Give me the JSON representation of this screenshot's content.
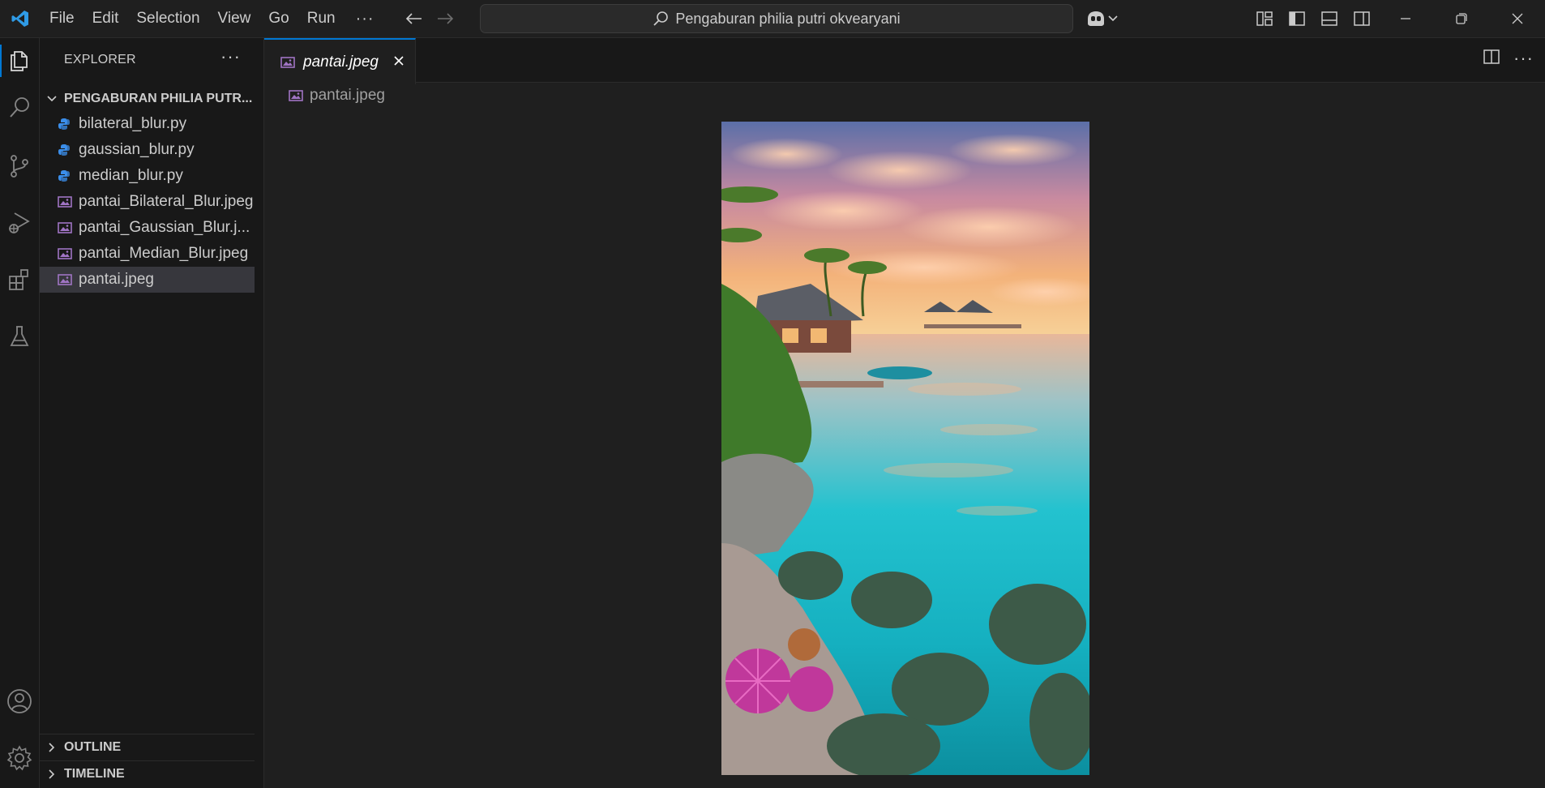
{
  "menu": [
    "File",
    "Edit",
    "Selection",
    "View",
    "Go",
    "Run"
  ],
  "menu_more": "···",
  "search_text": "Pengaburan philia putri okvearyani",
  "activity_icons": [
    "explorer-icon",
    "search-icon",
    "source-control-icon",
    "run-debug-icon",
    "extensions-icon",
    "testing-icon",
    "account-icon",
    "settings-gear-icon"
  ],
  "sidebar": {
    "title": "EXPLORER",
    "more": "···",
    "folder": "PENGABURAN PHILIA PUTR...",
    "files": [
      {
        "name": "bilateral_blur.py",
        "type": "python"
      },
      {
        "name": "gaussian_blur.py",
        "type": "python"
      },
      {
        "name": "median_blur.py",
        "type": "python"
      },
      {
        "name": "pantai_Bilateral_Blur.jpeg",
        "type": "image"
      },
      {
        "name": "pantai_Gaussian_Blur.j...",
        "type": "image"
      },
      {
        "name": "pantai_Median_Blur.jpeg",
        "type": "image"
      },
      {
        "name": "pantai.jpeg",
        "type": "image",
        "selected": true
      }
    ],
    "sections": [
      "OUTLINE",
      "TIMELINE"
    ]
  },
  "editor": {
    "tab_label": "pantai.jpeg",
    "breadcrumb": "pantai.jpeg",
    "editor_more": "···"
  },
  "colors": {
    "accent": "#0078d4",
    "python_icon": "#3b8eea",
    "image_icon": "#a074c4"
  }
}
